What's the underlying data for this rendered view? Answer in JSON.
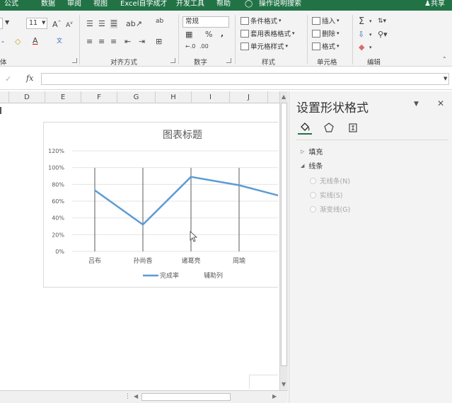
{
  "ribbon_tabs": [
    "公式",
    "数据",
    "审阅",
    "视图",
    "Excel自学成才",
    "开发工具",
    "帮助"
  ],
  "tell_me": "操作说明搜索",
  "share": "共享",
  "ribbon": {
    "font_size": "11",
    "number_format": "常规",
    "percent": "%",
    "comma": ",",
    "conditional_format": "条件格式",
    "table_format": "套用表格格式",
    "cell_styles": "单元格样式",
    "insert": "插入",
    "delete": "删除",
    "format": "格式",
    "group_font": "体",
    "group_alignment": "对齐方式",
    "group_number": "数字",
    "group_styles": "样式",
    "group_cells": "单元格",
    "group_editing": "编辑"
  },
  "formula_bar": {
    "fx": "fx",
    "value": ""
  },
  "columns": [
    "D",
    "E",
    "F",
    "G",
    "H",
    "I",
    "J"
  ],
  "pane": {
    "title": "设置形状格式",
    "section_fill": "填充",
    "section_line": "线条",
    "line_options": [
      "无线条(N)",
      "实线(S)",
      "渐变线(G)"
    ]
  },
  "colors": {
    "accent": "#217346",
    "series": "#5b9bd5"
  },
  "chart_data": {
    "type": "line",
    "title": "图表标题",
    "categories": [
      "吕布",
      "孙尚香",
      "诸葛亮",
      "周瑜",
      ""
    ],
    "series": [
      {
        "name": "完成率",
        "values": [
          0.73,
          0.32,
          0.89,
          0.79,
          0.64
        ]
      },
      {
        "name": "辅助列",
        "values": [
          null,
          null,
          null,
          null,
          null
        ]
      }
    ],
    "yticks": [
      "0%",
      "20%",
      "40%",
      "60%",
      "80%",
      "100%",
      "120%"
    ],
    "ylim": [
      0,
      1.2
    ],
    "grid": true,
    "legend": "bottom"
  }
}
